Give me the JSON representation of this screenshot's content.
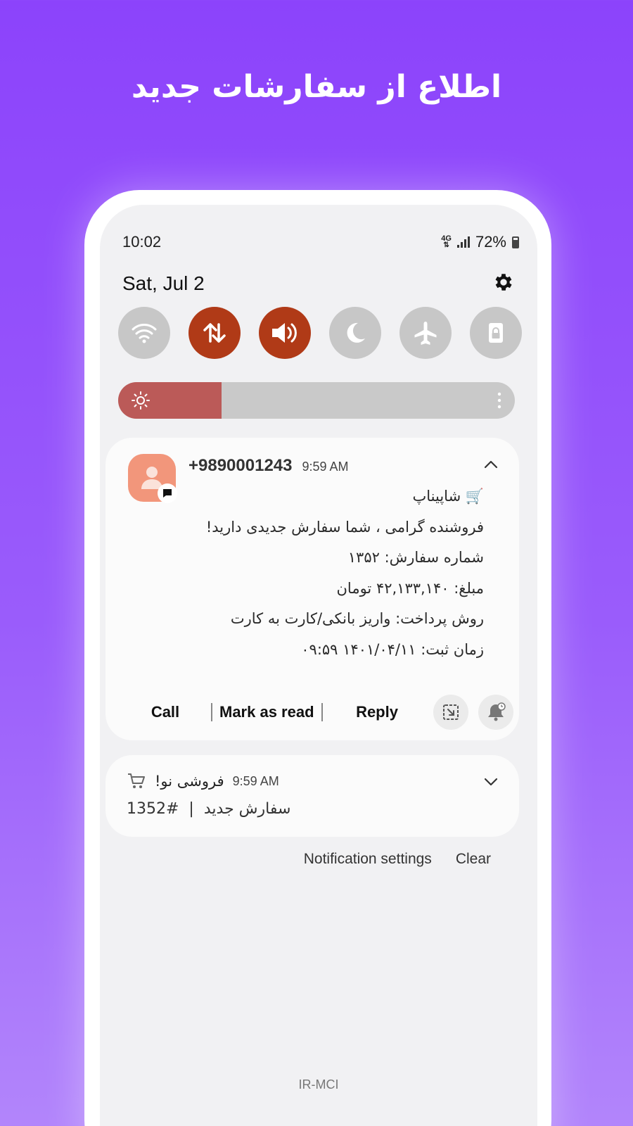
{
  "headline": "اطلاع از سفارشات جدید",
  "status_bar": {
    "time": "10:02",
    "network": "4G",
    "battery": "72%"
  },
  "panel": {
    "date": "Sat, Jul 2"
  },
  "quick_toggles": [
    {
      "name": "wifi",
      "on": false
    },
    {
      "name": "mobile-data",
      "on": true
    },
    {
      "name": "sound",
      "on": true
    },
    {
      "name": "night-mode",
      "on": false
    },
    {
      "name": "airplane-mode",
      "on": false
    },
    {
      "name": "screen-lock",
      "on": false
    }
  ],
  "brightness": {
    "level": 0.26
  },
  "notification_sms": {
    "sender": "+9890001243",
    "time": "9:59 AM",
    "lines": [
      "🛒 شاپیناپ",
      "فروشنده گرامی ، شما سفارش جدیدی دارید!",
      "شماره سفارش: ۱۳۵۲",
      "مبلغ: ۴۲,۱۳۳,۱۴۰ تومان",
      "روش پرداخت: واریز بانکی/کارت به کارت",
      "زمان ثبت: ۱۴۰۱/۰۴/۱۱ ۰۹:۵۹"
    ],
    "actions": {
      "call": "Call",
      "mark_read": "Mark as read",
      "reply": "Reply"
    }
  },
  "notification_shop": {
    "app_name": "فروشی نو!",
    "time": "9:59 AM",
    "order": "1352#",
    "separator": "|",
    "text": "سفارش جدید"
  },
  "footer": {
    "settings": "Notification settings",
    "clear": "Clear",
    "carrier": "IR-MCI"
  },
  "colors": {
    "background": "#8c43fb",
    "toggle_on": "#b03a17",
    "toggle_off": "#c7c7c7",
    "brightness_fill": "#bb5a58",
    "avatar": "#f2967b"
  }
}
